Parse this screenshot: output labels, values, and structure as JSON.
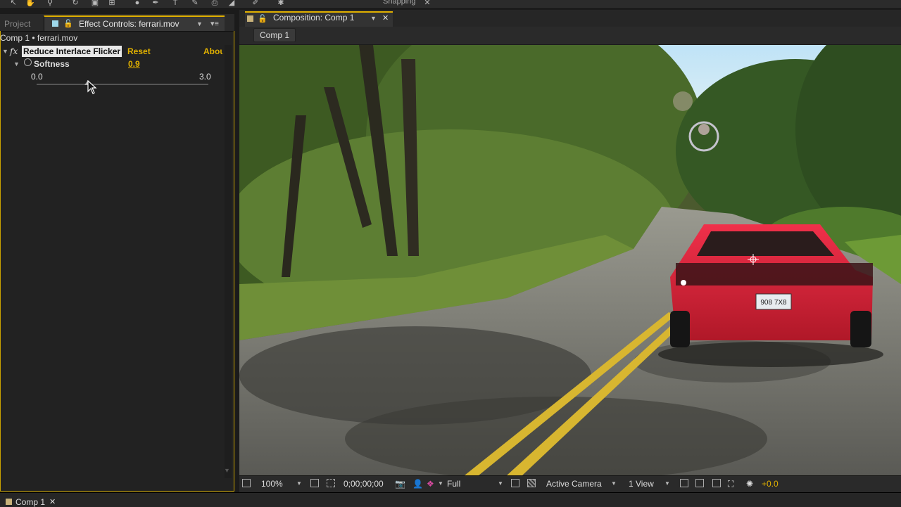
{
  "toolbar": {
    "snapping_label": "Snapping"
  },
  "left_panel": {
    "tabs": [
      {
        "label": "Project"
      },
      {
        "label": "Effect Controls: ferrari.mov"
      }
    ],
    "comp_layer": "Comp 1 • ferrari.mov",
    "fx_symbol": "fx",
    "effect_name": "Reduce Interlace Flicker",
    "reset_label": "Reset",
    "about_label": "About",
    "softness": {
      "label": "Softness",
      "value": "0.9",
      "min": "0.0",
      "max": "3.0",
      "level_fraction": 0.3
    }
  },
  "composition": {
    "tab_label": "Composition: Comp 1",
    "sub_tab": "Comp 1"
  },
  "viewer_controls": {
    "zoom": "100%",
    "timecode": "0;00;00;00",
    "resolution": "Full",
    "camera": "Active Camera",
    "views": "1 View",
    "exposure": "+0.0"
  },
  "bottom_bar": {
    "timeline_tab": "Comp 1"
  },
  "colors": {
    "accent": "#e0b000",
    "panel_bg": "#222222",
    "car": "#d7263d"
  },
  "scene": {
    "plate_text": "908 7X8"
  }
}
